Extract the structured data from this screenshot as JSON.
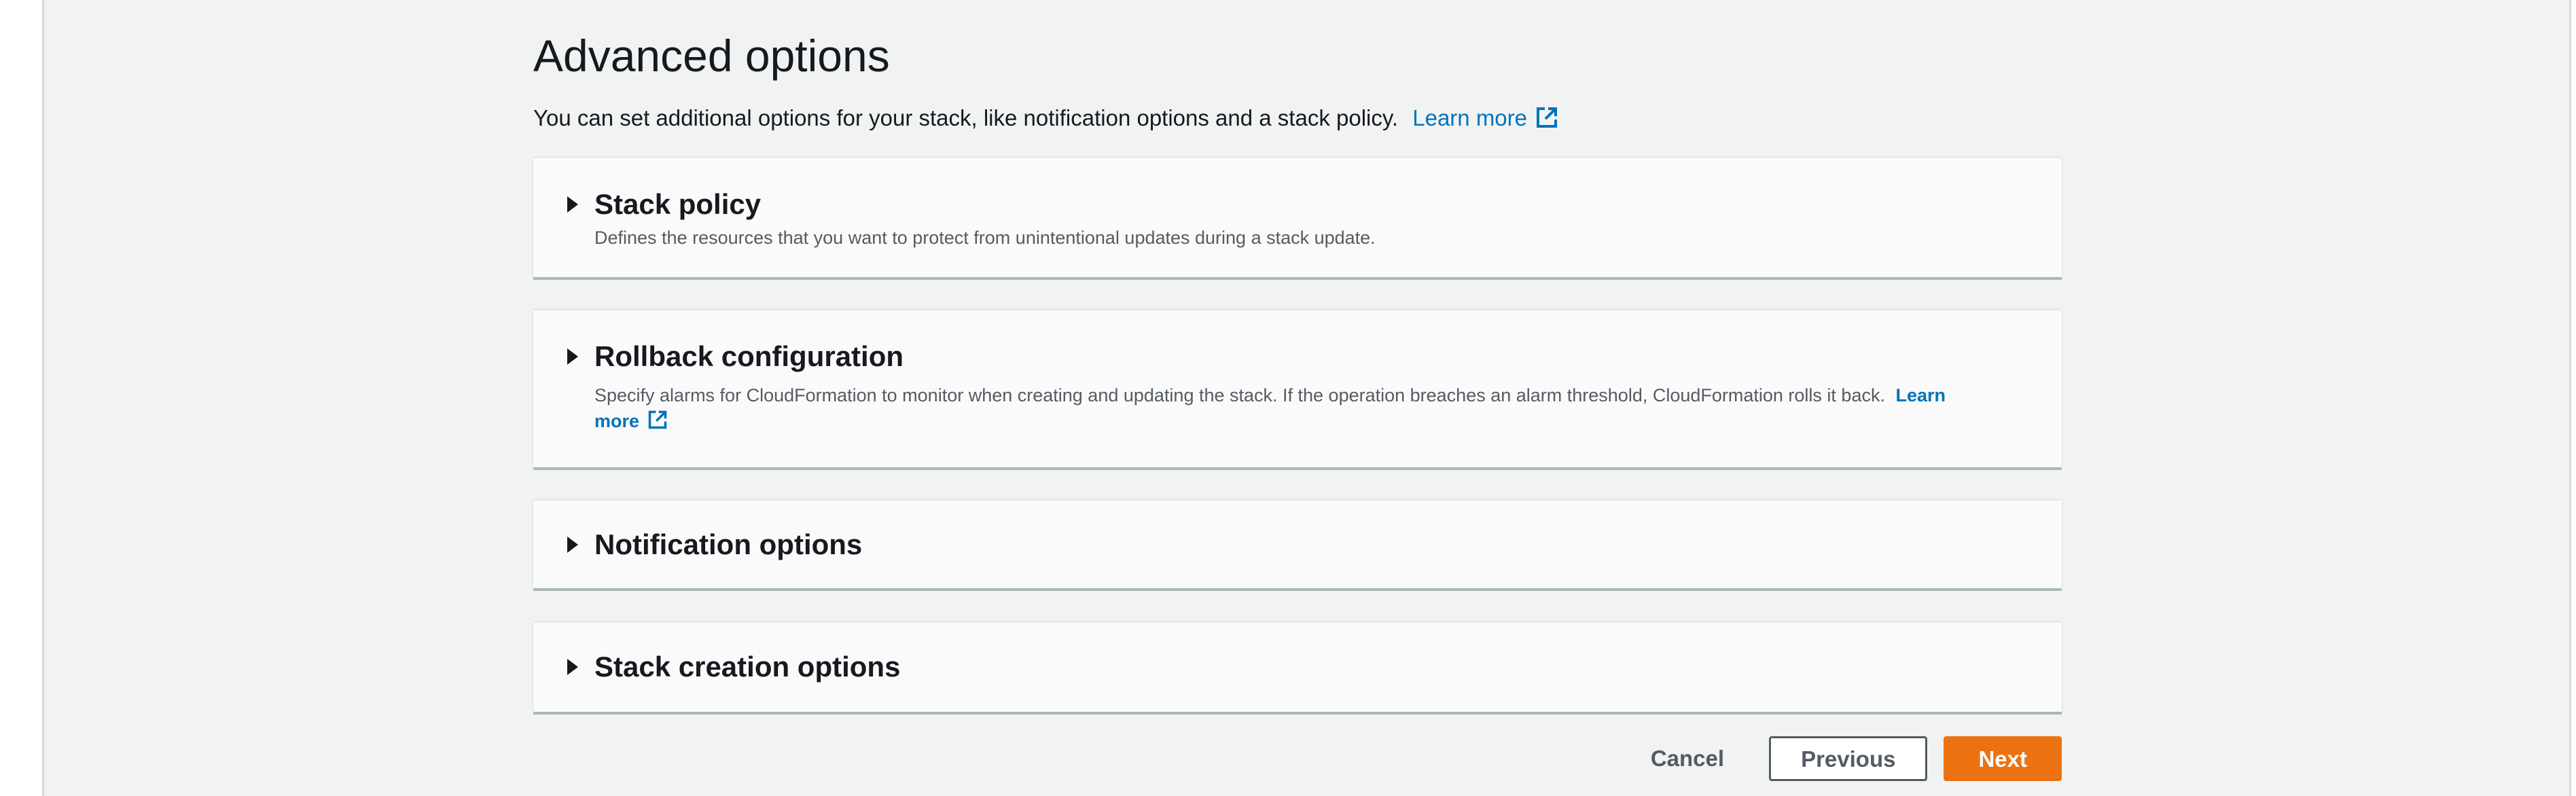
{
  "page": {
    "title": "Advanced options",
    "description": "You can set additional options for your stack, like notification options and a stack policy.",
    "learn_more": "Learn more"
  },
  "panels": [
    {
      "title": "Stack policy",
      "description": "Defines the resources that you want to protect from unintentional updates during a stack update."
    },
    {
      "title": "Rollback configuration",
      "description": "Specify alarms for CloudFormation to monitor when creating and updating the stack. If the operation breaches an alarm threshold, CloudFormation rolls it back.",
      "learn_more_line1": "Learn",
      "learn_more_line2": "more"
    },
    {
      "title": "Notification options"
    },
    {
      "title": "Stack creation options"
    }
  ],
  "actions": {
    "cancel": "Cancel",
    "previous": "Previous",
    "next": "Next"
  },
  "colors": {
    "link": "#0073bb",
    "primary": "#ec7211",
    "background": "#f1f3f3",
    "panel": "#fafafa"
  },
  "icons": {
    "external_link": "external-link-icon",
    "expand": "caret-right-icon"
  }
}
